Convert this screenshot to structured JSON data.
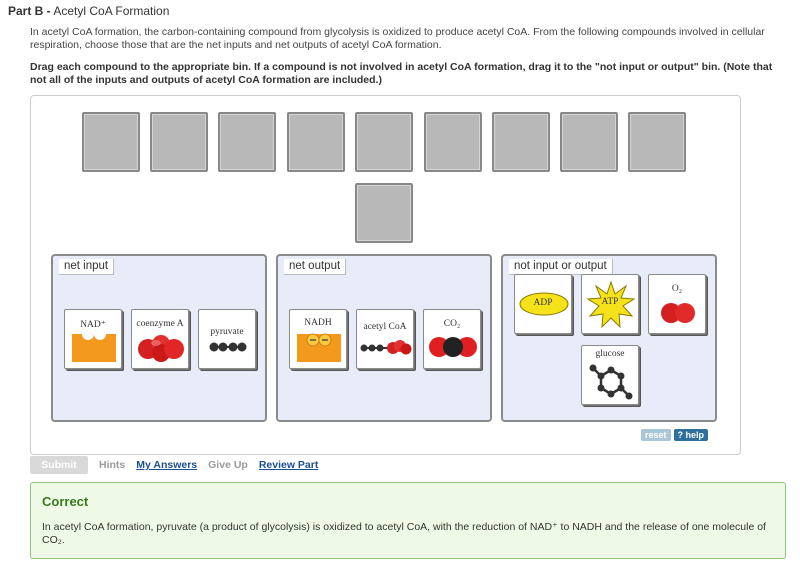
{
  "part": {
    "prefix": "Part B -",
    "title": "Acetyl CoA Formation"
  },
  "intro_text": "In acetyl CoA formation, the carbon-containing compound from glycolysis is oxidized to produce acetyl CoA. From the following compounds involved in cellular respiration, choose those that are the net inputs and net outputs of acetyl CoA formation.",
  "instructions": "Drag each compound to the appropriate bin. If a compound is not involved in acetyl CoA formation, drag it to the \"not input or output\" bin. (Note that not all of the inputs and outputs of acetyl CoA formation are included.)",
  "bins": {
    "net_input": {
      "label": "net input",
      "cards": [
        {
          "label": "NAD⁺",
          "icon": "nad-icon"
        },
        {
          "label": "coenzyme A",
          "icon": "coenzyme-a-icon"
        },
        {
          "label": "pyruvate",
          "icon": "pyruvate-icon"
        }
      ]
    },
    "net_output": {
      "label": "net output",
      "cards": [
        {
          "label": "NADH",
          "icon": "nadh-icon"
        },
        {
          "label": "acetyl CoA",
          "icon": "acetyl-coa-icon"
        },
        {
          "label": "CO₂",
          "icon": "co2-icon"
        }
      ]
    },
    "not_io": {
      "label": "not input or output",
      "cards": [
        {
          "label": "ADP",
          "icon": "adp-icon"
        },
        {
          "label": "ATP",
          "icon": "atp-icon"
        },
        {
          "label": "O₂",
          "icon": "o2-icon"
        },
        {
          "label": "glucose",
          "icon": "glucose-icon"
        }
      ]
    }
  },
  "tools": {
    "reset": "reset",
    "help": "? help"
  },
  "actions": {
    "submit": "Submit",
    "hints": "Hints",
    "my_answers": "My Answers",
    "give_up": "Give Up",
    "review_part": "Review Part"
  },
  "feedback": {
    "title": "Correct",
    "message": "In acetyl CoA formation, pyruvate (a product of glycolysis) is oxidized to acetyl CoA, with the reduction of NAD⁺ to NADH and the release of one molecule of CO₂."
  },
  "colors": {
    "accent": "#1d4f91",
    "correct": "#3a7a1f",
    "orange": "#f39a1c",
    "red": "#e02020"
  }
}
